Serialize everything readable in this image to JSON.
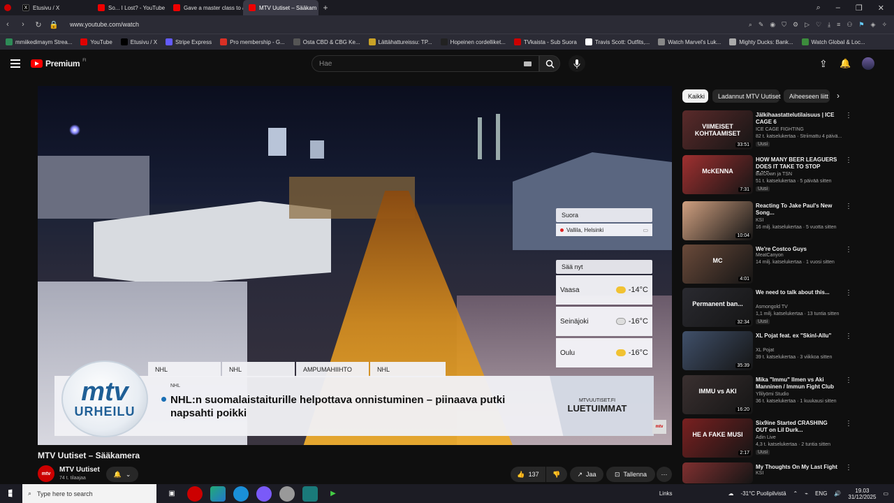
{
  "browser": {
    "tabs": [
      {
        "title": "Etusivu / X",
        "icon": "x-icon"
      },
      {
        "title": "So... I Lost? - YouTube",
        "icon": "youtube-icon"
      },
      {
        "title": "Gave a master class to a b",
        "icon": "youtube-icon"
      },
      {
        "title": "MTV Uutiset – Sääkam",
        "icon": "youtube-icon",
        "active": true
      }
    ],
    "url": "www.youtube.com/watch",
    "bookmarks": [
      {
        "label": "mmiikedimaym Strea...",
        "color": "#2e8b57"
      },
      {
        "label": "YouTube",
        "color": "#e00000"
      },
      {
        "label": "Etusivu / X",
        "color": "#000000"
      },
      {
        "label": "Stripe Express",
        "color": "#635bff"
      },
      {
        "label": "Pro membership - G...",
        "color": "#d93025"
      },
      {
        "label": "Osta CBD & CBG Ke...",
        "color": "#555555"
      },
      {
        "label": "Lättähattureissu: TP...",
        "color": "#c9a227"
      },
      {
        "label": "Hopeinen cordelliket...",
        "color": "#222222"
      },
      {
        "label": "TVkaista - Sub Suora",
        "color": "#cc0000"
      },
      {
        "label": "Travis Scott: Outfits,...",
        "color": "#ffffff"
      },
      {
        "label": "Watch Marvel's Luk...",
        "color": "#888888"
      },
      {
        "label": "Mighty Ducks: Bank...",
        "color": "#aaaaaa"
      },
      {
        "label": "Watch Global & Loc...",
        "color": "#3c8c3c"
      }
    ]
  },
  "youtube": {
    "logo": "Premium",
    "logo_sup": "FI",
    "search_placeholder": "Hae"
  },
  "overlay": {
    "live_label": "Suora",
    "location": "Vallila, Helsinki",
    "weather_title": "Sää nyt",
    "weather": [
      {
        "city": "Vaasa",
        "temp": "-14°C"
      },
      {
        "city": "Seinäjoki",
        "temp": "-16°C"
      },
      {
        "city": "Oulu",
        "temp": "-16°C"
      }
    ],
    "news_tabs": [
      "NHL",
      "NHL",
      "AMPUMAHIIHTO",
      "NHL"
    ],
    "logo_top": "mtv",
    "logo_bottom": "URHEILU",
    "category_small": "NHL",
    "headline": "NHL:n suomalaistaiturille helpottava onnistuminen – piinaava putki napsahti poikki",
    "right_small": "MTVUUTISET.FI",
    "right_big": "LUETUIMMAT",
    "corner_badge": "mtv"
  },
  "video": {
    "title": "MTV Uutiset – Sääkamera",
    "channel": "MTV Uutiset",
    "avatar_text": "mtv",
    "subscribers": "74 t. tilaajaa",
    "likes": "137",
    "share": "Jaa",
    "save": "Tallenna"
  },
  "sidebar": {
    "chips": [
      "Kaikki",
      "Ladannut MTV Uutiset",
      "Aiheeseen liitt"
    ],
    "items": [
      {
        "title": "Jälkihaastattelutilaisuus | ICE CAGE 6",
        "channel": "ICE CAGE FIGHTING",
        "meta": "82 t. katselukertaa · Striimattu 4 päivä...",
        "badge": "Uusi",
        "duration": "33:51",
        "thumb": "#5a2a2a",
        "thumb_text": "VIIMEISET KOHTAAMISET"
      },
      {
        "title": "HOW MANY BEER LEAGUERS DOES IT TAKE TO STOP GAVI...",
        "channel": "BarDown ja TSN",
        "meta": "51 t. katselukertaa · 5 päivää sitten",
        "badge": "Uusi",
        "duration": "7:31",
        "thumb": "#a03030",
        "thumb_text": "McKENNA"
      },
      {
        "title": "Reacting To Jake Paul's New Song...",
        "channel": "KSI",
        "meta": "16 milj. katselukertaa · 5 vuotta sitten",
        "badge": "",
        "duration": "10:04",
        "thumb": "#d0a080",
        "thumb_text": ""
      },
      {
        "title": "We're Costco Guys",
        "channel": "MeatCanyon",
        "meta": "14 milj. katselukertaa · 1 vuosi sitten",
        "badge": "",
        "duration": "4:01",
        "thumb": "#6a4a3a",
        "thumb_text": "MC"
      },
      {
        "title": "We need to talk about this...",
        "channel": "Asmongold TV",
        "meta": "1,1 milj. katselukertaa · 13 tuntia sitten",
        "badge": "Uusi",
        "duration": "32:34",
        "thumb": "#2a2a30",
        "thumb_text": "Permanent ban..."
      },
      {
        "title": "XL Pojat feat. ex \"Skinl-Allu\"",
        "channel": "XL Pojat",
        "meta": "39 t. katselukertaa · 3 viikkoa sitten",
        "badge": "",
        "duration": "35:39",
        "thumb": "#40506a",
        "thumb_text": ""
      },
      {
        "title": "Mika \"Immu\" Ilmen vs Aki Manninen / Immun Fight Club",
        "channel": "Yllilyömi Studio",
        "meta": "36 t. katselukertaa · 1 kuukausi sitten",
        "badge": "",
        "duration": "16:20",
        "thumb": "#3a3030",
        "thumb_text": "IMMU vs AKI"
      },
      {
        "title": "Six9ine Started CRASHING OUT on Lil Durk...",
        "channel": "Adin Live",
        "meta": "4,3 t. katselukertaa · 2 tuntia sitten",
        "badge": "Uusi",
        "duration": "2:17",
        "thumb": "#7a2020",
        "thumb_text": "HE A FAKE MUSI"
      },
      {
        "title": "My Thoughts On My Last Fight",
        "channel": "KSI",
        "meta": "",
        "badge": "",
        "duration": "",
        "thumb": "#803030",
        "thumb_text": ""
      }
    ]
  },
  "taskbar": {
    "search": "Type here to search",
    "links": "Links",
    "weather": "-31°C Puolipilvistä",
    "lang": "ENG",
    "time": "19.03",
    "date": "31/12/2025"
  }
}
